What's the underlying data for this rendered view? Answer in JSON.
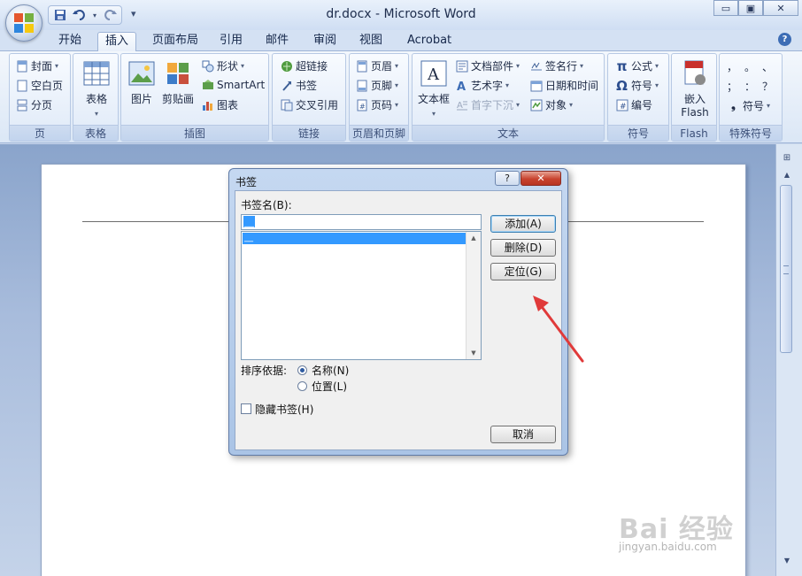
{
  "window": {
    "title": "dr.docx - Microsoft Word",
    "minimize": "▭",
    "restore": "▣",
    "close": "✕"
  },
  "tabs": [
    "开始",
    "插入",
    "页面布局",
    "引用",
    "邮件",
    "审阅",
    "视图",
    "Acrobat"
  ],
  "active_tab": "插入",
  "ribbon": {
    "pages": {
      "label": "页",
      "items": [
        "封面",
        "空白页",
        "分页"
      ]
    },
    "tables": {
      "label": "表格",
      "button": "表格"
    },
    "illustrations": {
      "label": "插图",
      "picture": "图片",
      "clipart": "剪贴画",
      "shapes": "形状",
      "smartart": "SmartArt",
      "chart": "图表"
    },
    "links": {
      "label": "链接",
      "hyperlink": "超链接",
      "bookmark": "书签",
      "crossref": "交叉引用"
    },
    "header_footer": {
      "label": "页眉和页脚",
      "header": "页眉",
      "footer": "页脚",
      "page_number": "页码"
    },
    "text": {
      "label": "文本",
      "textbox": "文本框",
      "quickparts": "文档部件",
      "wordart": "艺术字",
      "dropcap": "首字下沉",
      "signature": "签名行",
      "datetime": "日期和时间",
      "object": "对象"
    },
    "symbols": {
      "label": "符号",
      "equation": "公式",
      "symbol": "符号",
      "numbering": "编号"
    },
    "flash": {
      "label": "Flash",
      "embed": "嵌入",
      "embed2": "Flash"
    },
    "special": {
      "label": "特殊符号",
      "chars": [
        "，",
        "。",
        "、",
        "；",
        "：",
        "？"
      ],
      "symbol": "符号"
    }
  },
  "dialog": {
    "title": "书签",
    "help": "?",
    "close": "✕",
    "name_label": "书签名(B):",
    "name_value": "__",
    "list_items": [
      "__"
    ],
    "buttons": {
      "add": "添加(A)",
      "delete": "删除(D)",
      "goto": "定位(G)",
      "cancel": "取消"
    },
    "sort_label": "排序依据:",
    "sort_options": [
      {
        "label": "名称(N)",
        "checked": true
      },
      {
        "label": "位置(L)",
        "checked": false
      }
    ],
    "hidden_label": "隐藏书签(H)",
    "hidden_checked": false
  },
  "watermark": {
    "text": "Bai 经验",
    "url": "jingyan.baidu.com"
  },
  "colors": {
    "accent_blue": "#3399ff",
    "annotation_red": "#e03a3a"
  }
}
